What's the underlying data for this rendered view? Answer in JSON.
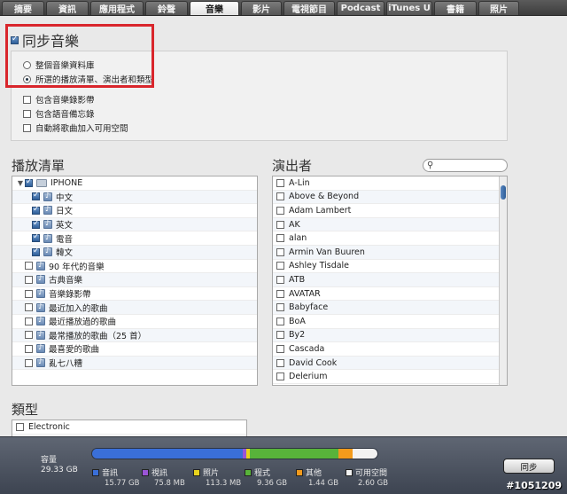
{
  "tabs": [
    {
      "label": "摘要",
      "width": 48
    },
    {
      "label": "資訊",
      "width": 48
    },
    {
      "label": "應用程式",
      "width": 60
    },
    {
      "label": "鈴聲",
      "width": 48
    },
    {
      "label": "音樂",
      "width": 56,
      "active": true
    },
    {
      "label": "影片",
      "width": 46
    },
    {
      "label": "電視節目",
      "width": 58
    },
    {
      "label": "Podcast",
      "width": 54
    },
    {
      "label": "iTunes U",
      "width": 52
    },
    {
      "label": "書籍",
      "width": 48
    },
    {
      "label": "照片",
      "width": 46
    }
  ],
  "sync": {
    "title": "同步音樂",
    "checked": true,
    "options": [
      {
        "label": "整個音樂資料庫",
        "selected": false
      },
      {
        "label": "所選的播放清單、演出者和類型",
        "selected": true
      }
    ],
    "checkboxes": [
      {
        "label": "包含音樂錄影帶",
        "checked": false
      },
      {
        "label": "包含語音備忘錄",
        "checked": false
      },
      {
        "label": "自動將歌曲加入可用空間",
        "checked": false
      }
    ]
  },
  "playlists": {
    "heading": "播放清單",
    "items": [
      {
        "label": "IPHONE",
        "level": 0,
        "checked": true,
        "folder": true
      },
      {
        "label": "中文",
        "level": 1,
        "checked": true
      },
      {
        "label": "日文",
        "level": 1,
        "checked": true
      },
      {
        "label": "英文",
        "level": 1,
        "checked": true
      },
      {
        "label": "電音",
        "level": 1,
        "checked": true
      },
      {
        "label": "韓文",
        "level": 1,
        "checked": true
      },
      {
        "label": "90 年代的音樂",
        "level": 0,
        "checked": false
      },
      {
        "label": "古典音樂",
        "level": 0,
        "checked": false
      },
      {
        "label": "音樂錄影帶",
        "level": 0,
        "checked": false
      },
      {
        "label": "最近加入的歌曲",
        "level": 0,
        "checked": false
      },
      {
        "label": "最近播放過的歌曲",
        "level": 0,
        "checked": false
      },
      {
        "label": "最常播放的歌曲（25 首）",
        "level": 0,
        "checked": false
      },
      {
        "label": "最喜愛的歌曲",
        "level": 0,
        "checked": false
      },
      {
        "label": "亂七八糟",
        "level": 0,
        "checked": false
      }
    ]
  },
  "artists": {
    "heading": "演出者",
    "search_placeholder": "",
    "items": [
      "A-Lin",
      "Above & Beyond",
      "Adam Lambert",
      "AK",
      "alan",
      "Armin Van Buuren",
      "Ashley Tisdale",
      "ATB",
      "AVATAR",
      "Babyface",
      "BoA",
      "By2",
      "Cascada",
      "David Cook",
      "Delerium"
    ]
  },
  "genres": {
    "heading": "類型",
    "items": [
      "Electronic"
    ]
  },
  "footer": {
    "capacity_label": "容量",
    "capacity_total": "29.33 GB",
    "segments": [
      {
        "name": "音訊",
        "value": "15.77 GB",
        "color": "#3a6fd8",
        "gb": 15.77
      },
      {
        "name": "視訊",
        "value": "75.8 MB",
        "color": "#9a55d6",
        "gb": 0.076
      },
      {
        "name": "照片",
        "value": "113.3 MB",
        "color": "#e8d31d",
        "gb": 0.113
      },
      {
        "name": "程式",
        "value": "9.36 GB",
        "color": "#58b33a",
        "gb": 9.36
      },
      {
        "name": "其他",
        "value": "1.44 GB",
        "color": "#f29a1c",
        "gb": 1.44
      },
      {
        "name": "可用空間",
        "value": "2.60 GB",
        "color": "#f2f2f2",
        "gb": 2.6
      }
    ],
    "sync_button": "同步",
    "watermark": "#1051209"
  }
}
